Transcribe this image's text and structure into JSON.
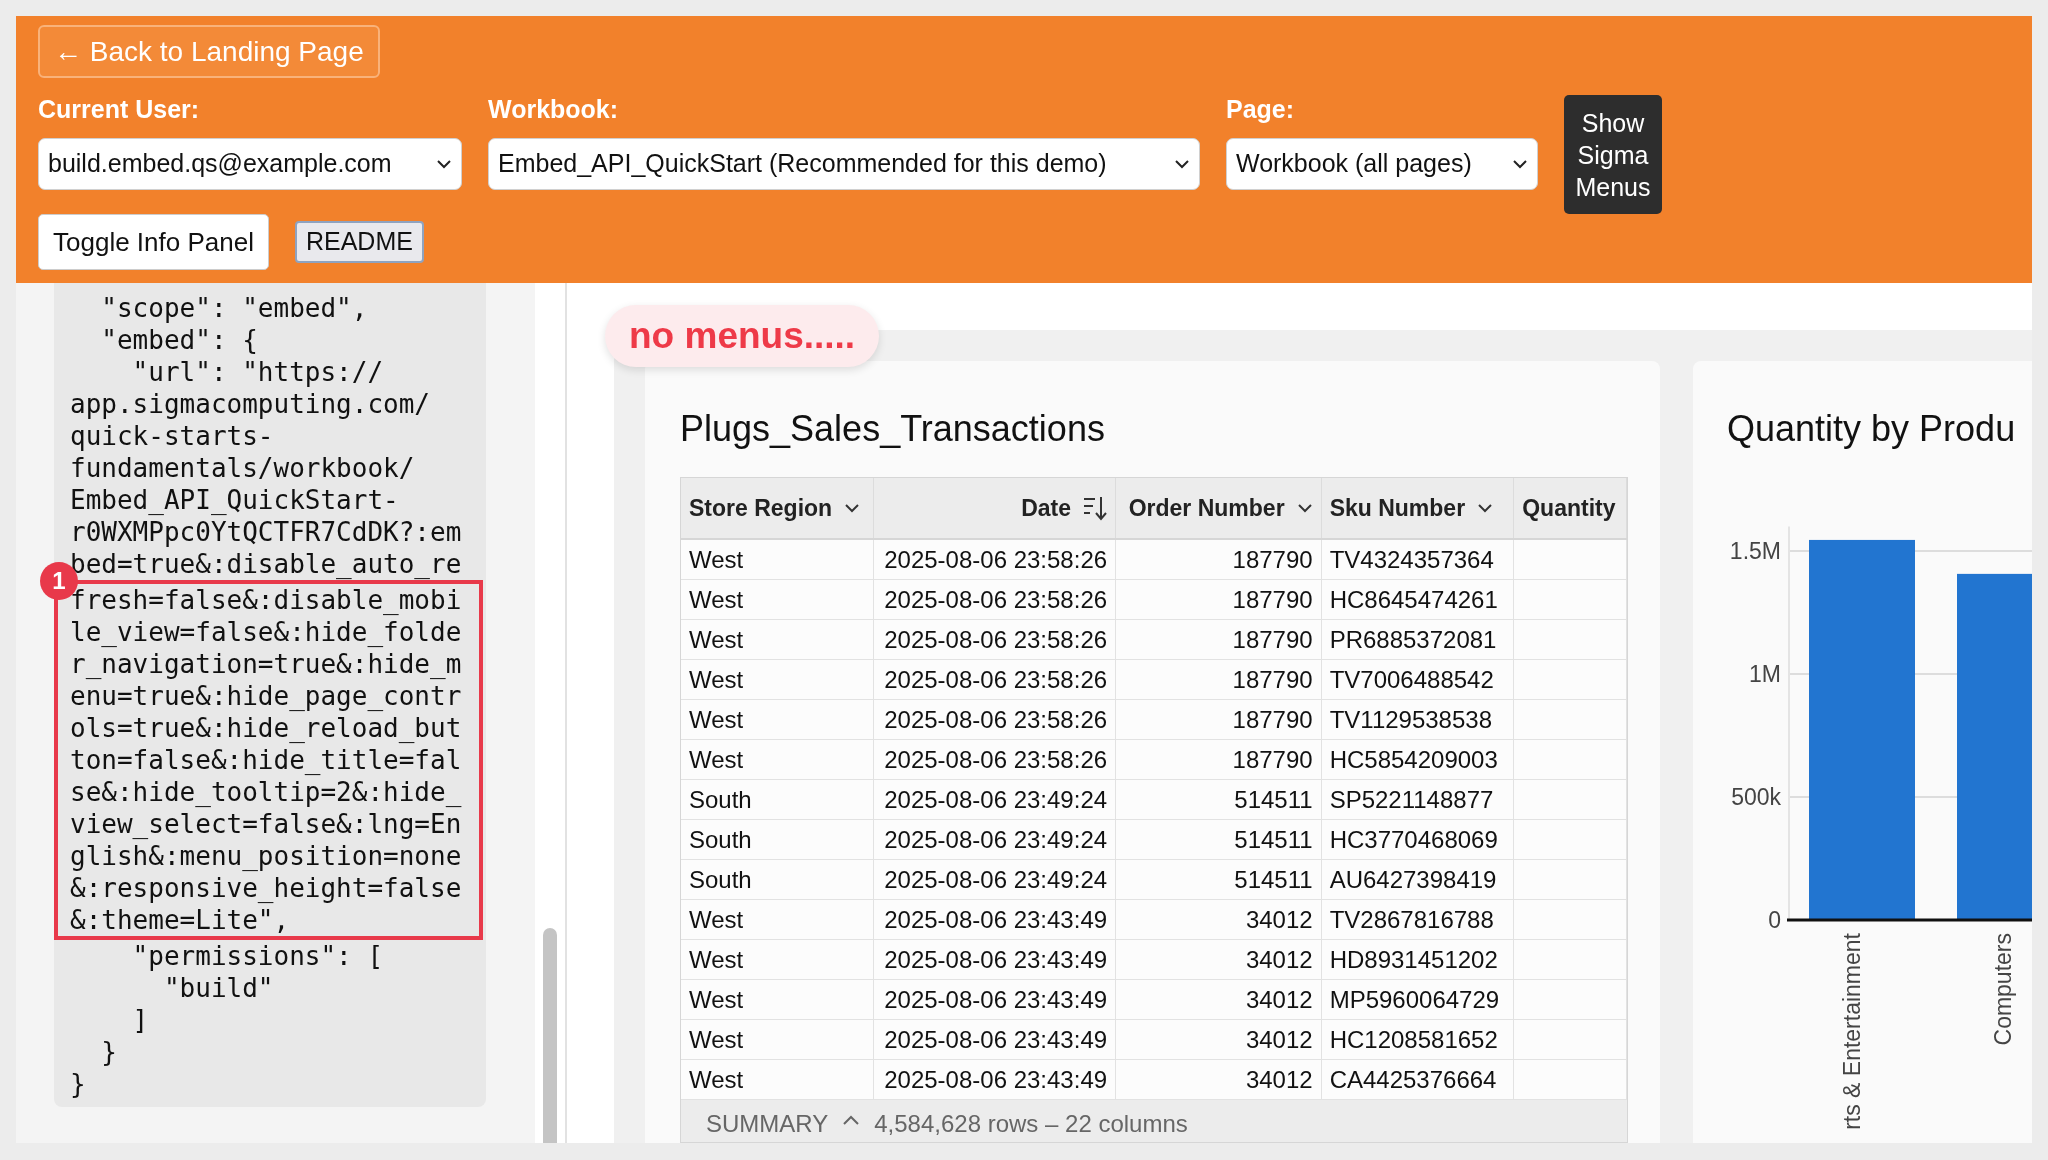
{
  "header": {
    "back_button": "← Back to Landing Page",
    "fields": [
      {
        "label": "Current User:",
        "value": "build.embed.qs@example.com"
      },
      {
        "label": "Workbook:",
        "value": "Embed_API_QuickStart (Recommended for this demo)"
      },
      {
        "label": "Page:",
        "value": "Workbook (all pages)"
      }
    ],
    "menus_button": "Show Sigma Menus",
    "buttons": [
      {
        "label": "Toggle Info Panel",
        "kind": "primary"
      },
      {
        "label": "README",
        "kind": "secondary"
      }
    ]
  },
  "info_panel": {
    "lines_before": [
      "  \"scope\": \"embed\",",
      "  \"embed\": {",
      "    \"url\": \"https://",
      "app.sigmacomputing.com/",
      "quick-starts-",
      "fundamentals/workbook/",
      "Embed_API_QuickStart-",
      "r0WXMPpc0YtQCTFR7CdDK?:em",
      "bed=true&:disable_auto_re"
    ],
    "callout": {
      "badge": "1",
      "lines": [
        "fresh=false&:disable_mobi",
        "le_view=false&:hide_folde",
        "r_navigation=true&:hide_m",
        "enu=true&:hide_page_contr",
        "ols=true&:hide_reload_but",
        "ton=false&:hide_title=fal",
        "se&:hide_tooltip=2&:hide_",
        "view_select=false&:lng=En",
        "glish&:menu_position=none",
        "&:responsive_height=false",
        "&:theme=Lite\","
      ]
    },
    "lines_after": [
      "    \"permissions\": [",
      "      \"build\"",
      "    ]",
      "  }",
      "}"
    ]
  },
  "note": "no menus.....",
  "table": {
    "title": "Plugs_Sales_Transactions",
    "columns": [
      {
        "label": "Store Region",
        "kind": "text",
        "sorted": false
      },
      {
        "label": "Date",
        "kind": "datetime",
        "sorted": true
      },
      {
        "label": "Order Number",
        "kind": "number",
        "sorted": false
      },
      {
        "label": "Sku Number",
        "kind": "text",
        "sorted": false
      },
      {
        "label": "Quantity",
        "kind": "number"
      }
    ],
    "rows": [
      [
        "West",
        "2025-08-06 23:58:26",
        "187790",
        "TV4324357364"
      ],
      [
        "West",
        "2025-08-06 23:58:26",
        "187790",
        "HC8645474261"
      ],
      [
        "West",
        "2025-08-06 23:58:26",
        "187790",
        "PR6885372081"
      ],
      [
        "West",
        "2025-08-06 23:58:26",
        "187790",
        "TV7006488542"
      ],
      [
        "West",
        "2025-08-06 23:58:26",
        "187790",
        "TV1129538538"
      ],
      [
        "West",
        "2025-08-06 23:58:26",
        "187790",
        "HC5854209003"
      ],
      [
        "South",
        "2025-08-06 23:49:24",
        "514511",
        "SP5221148877"
      ],
      [
        "South",
        "2025-08-06 23:49:24",
        "514511",
        "HC3770468069"
      ],
      [
        "South",
        "2025-08-06 23:49:24",
        "514511",
        "AU6427398419"
      ],
      [
        "West",
        "2025-08-06 23:43:49",
        "34012",
        "TV2867816788"
      ],
      [
        "West",
        "2025-08-06 23:43:49",
        "34012",
        "HD8931451202"
      ],
      [
        "West",
        "2025-08-06 23:43:49",
        "34012",
        "MP5960064729"
      ],
      [
        "West",
        "2025-08-06 23:43:49",
        "34012",
        "HC1208581652"
      ],
      [
        "West",
        "2025-08-06 23:43:49",
        "34012",
        "CA4425376664"
      ]
    ],
    "summary": {
      "label": "SUMMARY",
      "text": "4,584,628 rows – 22 columns"
    }
  },
  "chart": {
    "chart_data": {
      "type": "bar",
      "title": "Quantity by Produ",
      "categories": [
        "rts & Entertainment",
        "Computers"
      ],
      "values": [
        1545000,
        1407000
      ],
      "grid": true,
      "ylim": [
        0,
        1600000
      ],
      "yticks": [
        {
          "value": 0,
          "label": "0"
        },
        {
          "value": 500000,
          "label": "500k"
        },
        {
          "value": 1000000,
          "label": "1M"
        },
        {
          "value": 1500000,
          "label": "1.5M"
        }
      ]
    }
  }
}
